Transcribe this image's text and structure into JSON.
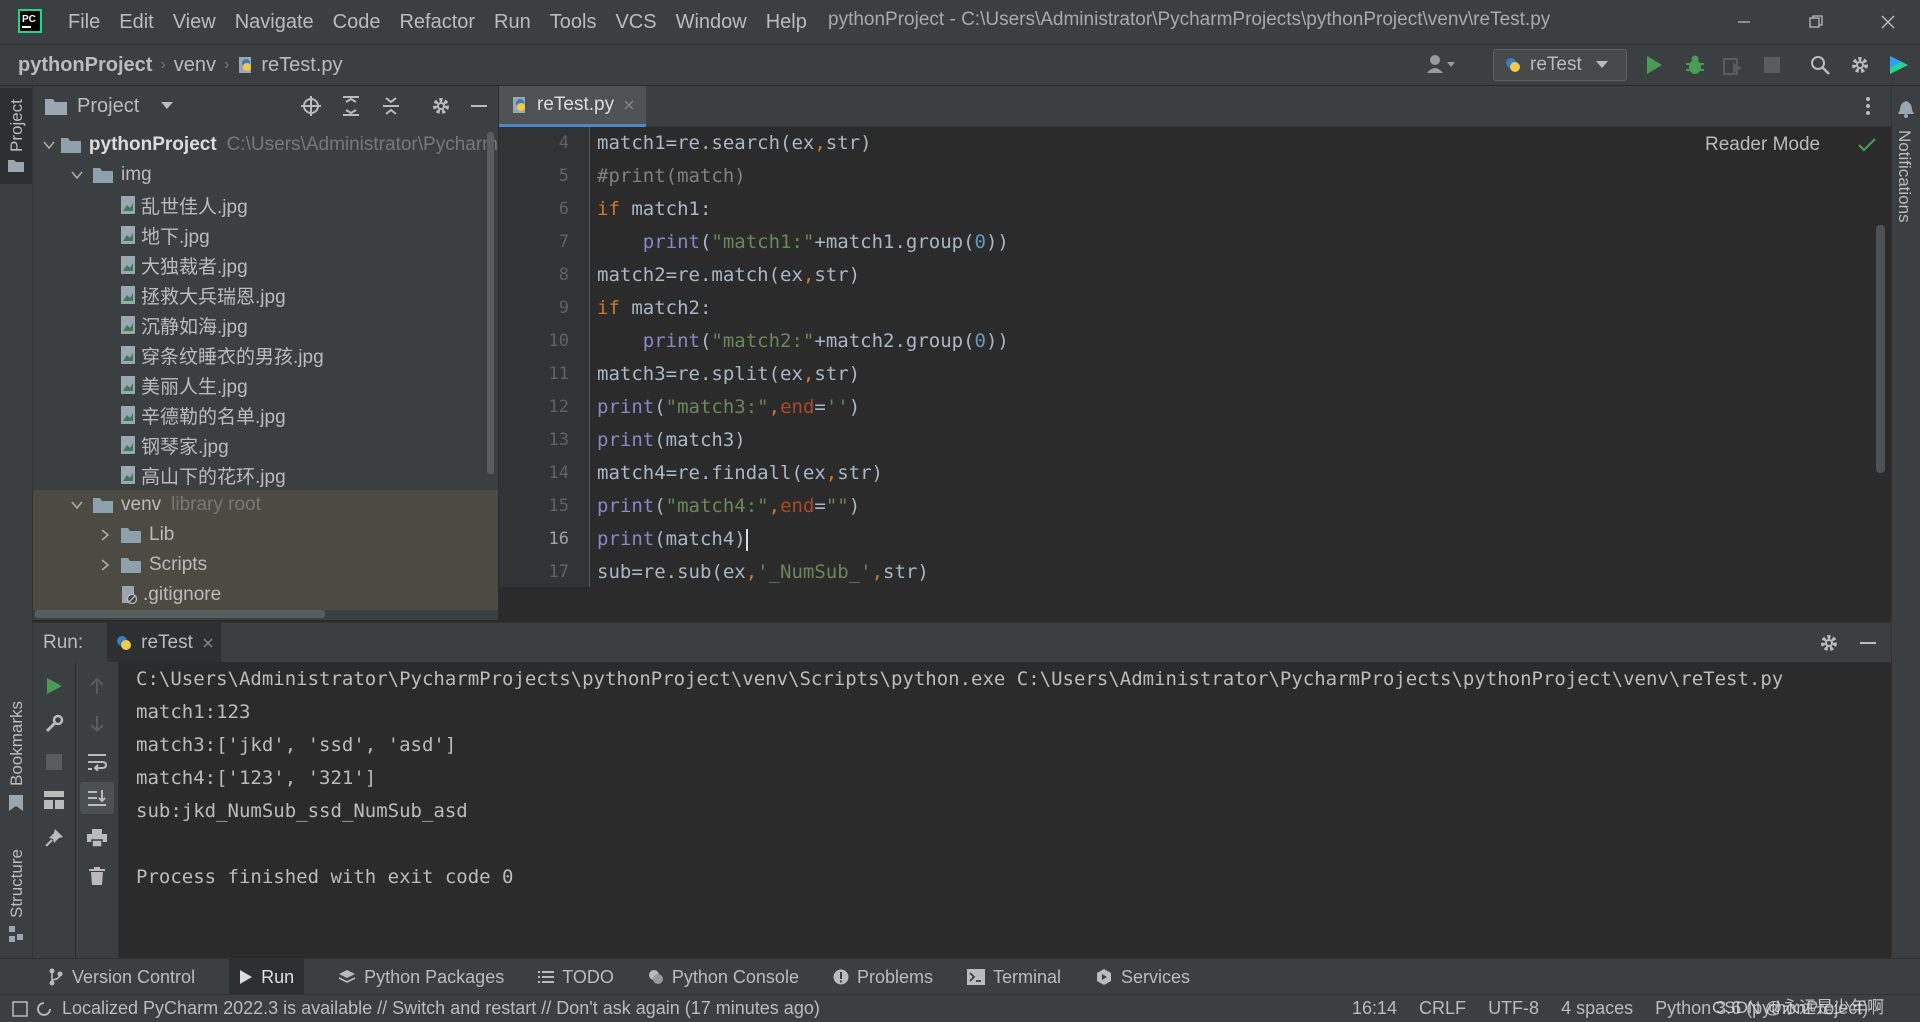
{
  "titlebar": {
    "menu": [
      "File",
      "Edit",
      "View",
      "Navigate",
      "Code",
      "Refactor",
      "Run",
      "Tools",
      "VCS",
      "Window",
      "Help"
    ],
    "menu_mnemonic": [
      "F",
      "E",
      "V",
      "N",
      "C",
      "R",
      "R",
      "T",
      "V",
      "W",
      "H"
    ],
    "window_title": "pythonProject - C:\\Users\\Administrator\\PycharmProjects\\pythonProject\\venv\\reTest.py"
  },
  "navbar": {
    "breadcrumbs": [
      "pythonProject",
      "venv",
      "reTest.py"
    ],
    "run_config": "reTest"
  },
  "project_panel": {
    "title": "Project",
    "tree": [
      {
        "label": "pythonProject",
        "extra": "C:\\Users\\Administrator\\Pycharm",
        "level": 0,
        "kind": "folder",
        "expanded": true,
        "bold": true
      },
      {
        "label": "img",
        "level": 1,
        "kind": "folder",
        "expanded": true
      },
      {
        "label": "乱世佳人.jpg",
        "level": 2,
        "kind": "image"
      },
      {
        "label": "地下.jpg",
        "level": 2,
        "kind": "image"
      },
      {
        "label": "大独裁者.jpg",
        "level": 2,
        "kind": "image"
      },
      {
        "label": "拯救大兵瑞恩.jpg",
        "level": 2,
        "kind": "image"
      },
      {
        "label": "沉静如海.jpg",
        "level": 2,
        "kind": "image"
      },
      {
        "label": "穿条纹睡衣的男孩.jpg",
        "level": 2,
        "kind": "image"
      },
      {
        "label": "美丽人生.jpg",
        "level": 2,
        "kind": "image"
      },
      {
        "label": "辛德勒的名单.jpg",
        "level": 2,
        "kind": "image"
      },
      {
        "label": "钢琴家.jpg",
        "level": 2,
        "kind": "image"
      },
      {
        "label": "高山下的花环.jpg",
        "level": 2,
        "kind": "image"
      },
      {
        "label": "venv",
        "extra": "library root",
        "level": 1,
        "kind": "folder",
        "expanded": true,
        "selected": true
      },
      {
        "label": "Lib",
        "level": 2,
        "kind": "folder",
        "expanded": false,
        "selected": true
      },
      {
        "label": "Scripts",
        "level": 2,
        "kind": "folder",
        "expanded": false,
        "selected": true
      },
      {
        "label": ".gitignore",
        "level": 2,
        "kind": "file",
        "selected": true
      }
    ]
  },
  "editor": {
    "tab": "reTest.py",
    "reader_mode": "Reader Mode",
    "lines": [
      {
        "n": "4",
        "tokens": [
          [
            "",
            "match1=re.search(ex"
          ],
          [
            "kw",
            ","
          ],
          [
            "",
            "str)"
          ]
        ]
      },
      {
        "n": "5",
        "tokens": [
          [
            "cm",
            "#print(match)"
          ]
        ]
      },
      {
        "n": "6",
        "tokens": [
          [
            "kw",
            "if "
          ],
          [
            "",
            "match1:"
          ]
        ]
      },
      {
        "n": "7",
        "tokens": [
          [
            "",
            "    "
          ],
          [
            "fn",
            "print"
          ],
          [
            "",
            "("
          ],
          [
            "st",
            "\"match1:\""
          ],
          [
            "",
            "+match1.group("
          ],
          [
            "nm",
            "0"
          ],
          [
            "",
            "))"
          ]
        ]
      },
      {
        "n": "8",
        "tokens": [
          [
            "",
            "match2=re.match(ex"
          ],
          [
            "kw",
            ","
          ],
          [
            "",
            "str)"
          ]
        ]
      },
      {
        "n": "9",
        "tokens": [
          [
            "kw",
            "if "
          ],
          [
            "",
            "match2:"
          ]
        ]
      },
      {
        "n": "10",
        "tokens": [
          [
            "",
            "    "
          ],
          [
            "fn",
            "print"
          ],
          [
            "",
            "("
          ],
          [
            "st",
            "\"match2:\""
          ],
          [
            "",
            "+match2.group("
          ],
          [
            "nm",
            "0"
          ],
          [
            "",
            "))"
          ]
        ]
      },
      {
        "n": "11",
        "tokens": [
          [
            "",
            "match3=re.split(ex"
          ],
          [
            "kw",
            ","
          ],
          [
            "",
            "str)"
          ]
        ]
      },
      {
        "n": "12",
        "tokens": [
          [
            "fn",
            "print"
          ],
          [
            "",
            "("
          ],
          [
            "st",
            "\"match3:\""
          ],
          [
            "kw",
            ","
          ],
          [
            "pr",
            "end"
          ],
          [
            "",
            "="
          ],
          [
            "st",
            "''"
          ],
          [
            "",
            ")"
          ]
        ]
      },
      {
        "n": "13",
        "tokens": [
          [
            "fn",
            "print"
          ],
          [
            "",
            "(match3)"
          ]
        ]
      },
      {
        "n": "14",
        "tokens": [
          [
            "",
            "match4=re.findall(ex"
          ],
          [
            "kw",
            ","
          ],
          [
            "",
            "str)"
          ]
        ]
      },
      {
        "n": "15",
        "tokens": [
          [
            "fn",
            "print"
          ],
          [
            "",
            "("
          ],
          [
            "st",
            "\"match4:\""
          ],
          [
            "kw",
            ","
          ],
          [
            "pr",
            "end"
          ],
          [
            "",
            "="
          ],
          [
            "st",
            "\"\""
          ],
          [
            "",
            ")"
          ]
        ]
      },
      {
        "n": "16",
        "tokens": [
          [
            "fn",
            "print"
          ],
          [
            "",
            "(match4)"
          ]
        ]
      },
      {
        "n": "17",
        "tokens": [
          [
            "",
            "sub=re.sub(ex"
          ],
          [
            "kw",
            ","
          ],
          [
            "st",
            "'_NumSub_'"
          ],
          [
            "kw",
            ","
          ],
          [
            "",
            "str)"
          ]
        ]
      }
    ]
  },
  "run_panel": {
    "label": "Run:",
    "tab": "reTest",
    "output": [
      "C:\\Users\\Administrator\\PycharmProjects\\pythonProject\\venv\\Scripts\\python.exe C:\\Users\\Administrator\\PycharmProjects\\pythonProject\\venv\\reTest.py",
      "match1:123",
      "match3:['jkd', 'ssd', 'asd']",
      "match4:['123', '321']",
      "sub:jkd_NumSub_ssd_NumSub_asd",
      "",
      "Process finished with exit code 0"
    ]
  },
  "side_strips": {
    "left": [
      "Project",
      "Bookmarks",
      "Structure"
    ],
    "right": [
      "Notifications"
    ]
  },
  "tool_tabs": [
    "Version Control",
    "Run",
    "Python Packages",
    "TODO",
    "Python Console",
    "Problems",
    "Terminal",
    "Services"
  ],
  "status": {
    "message": "Localized PyCharm 2022.3 is available // Switch and restart // Don't ask again (17 minutes ago)",
    "position": "16:14",
    "line_sep": "CRLF",
    "encoding": "UTF-8",
    "indent": "4 spaces",
    "interpreter": "Python 3.6 (pythonProject)",
    "watermark": "CSDN @永远是少年啊"
  },
  "colors": {
    "accent": "#4a88c7",
    "run_green": "#499c54",
    "keyword": "#cc7832",
    "string": "#6a8759",
    "number": "#6897bb",
    "builtin": "#8888c6"
  }
}
